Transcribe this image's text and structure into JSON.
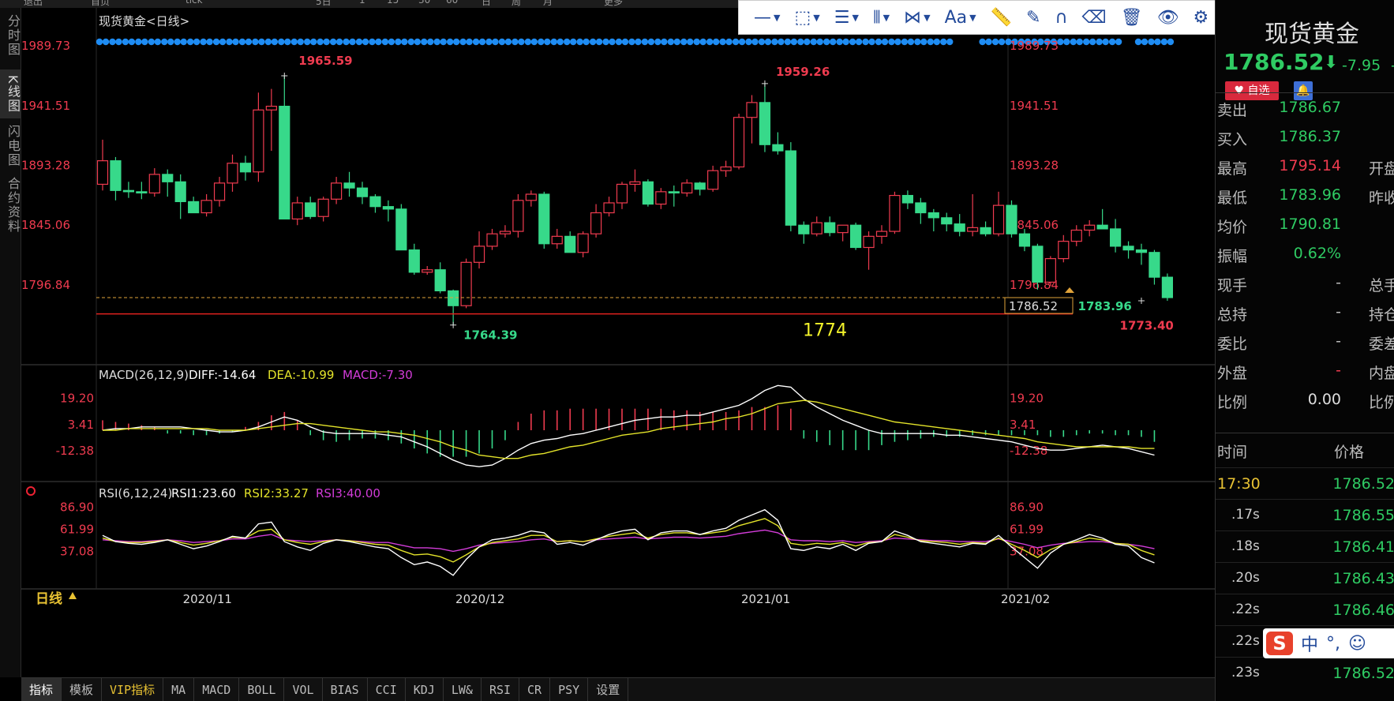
{
  "top_tabs": [
    "退出",
    "首页",
    "tick",
    "5日",
    "1",
    "15",
    "30",
    "60",
    "日",
    "周",
    "月",
    "更多"
  ],
  "left_tabs": [
    {
      "label": "分时图",
      "active": false
    },
    {
      "label": "K线图",
      "active": true
    },
    {
      "label": "闪电图",
      "active": false
    },
    {
      "label": "合约资料",
      "active": false
    }
  ],
  "toolbar": {
    "icons": [
      "line-tool-icon",
      "rect-tool-icon",
      "fib-tool-icon",
      "period-tool-icon",
      "pattern-tool-icon",
      "text-tool-icon",
      "ruler-icon",
      "pen-icon",
      "magnet-icon",
      "eraser-icon",
      "trash-icon",
      "eye-icon",
      "gear-icon",
      "close-icon"
    ],
    "text_label": "Aa"
  },
  "chart_data": [
    {
      "type": "candlestick",
      "title": "现货黄金<日线>",
      "ylim": [
        1740,
        2000
      ],
      "y_ticks": [
        1989.73,
        1941.51,
        1893.28,
        1845.06,
        1796.84
      ],
      "x_tick_labels": [
        "2020/11",
        "2020/12",
        "2021/01",
        "2021/02"
      ],
      "x_tick_indices": [
        8,
        29,
        51,
        71
      ],
      "up_color": "#ef3b4f",
      "down_color": "#37d98a",
      "ohlc": [
        [
          1878,
          1914,
          1873,
          1897
        ],
        [
          1897,
          1900,
          1865,
          1873
        ],
        [
          1873,
          1880,
          1867,
          1872
        ],
        [
          1872,
          1880,
          1866,
          1871
        ],
        [
          1871,
          1891,
          1868,
          1886
        ],
        [
          1886,
          1890,
          1868,
          1880
        ],
        [
          1880,
          1886,
          1850,
          1864
        ],
        [
          1864,
          1868,
          1855,
          1855
        ],
        [
          1855,
          1870,
          1852,
          1865
        ],
        [
          1865,
          1884,
          1860,
          1879
        ],
        [
          1879,
          1902,
          1872,
          1895
        ],
        [
          1895,
          1901,
          1881,
          1888
        ],
        [
          1888,
          1952,
          1880,
          1938
        ],
        [
          1938,
          1955,
          1905,
          1941
        ],
        [
          1941,
          1965.59,
          1850,
          1850
        ],
        [
          1850,
          1868,
          1845,
          1863
        ],
        [
          1863,
          1868,
          1850,
          1852
        ],
        [
          1852,
          1868,
          1848,
          1866
        ],
        [
          1866,
          1884,
          1862,
          1879
        ],
        [
          1879,
          1888,
          1868,
          1875
        ],
        [
          1875,
          1880,
          1862,
          1868
        ],
        [
          1868,
          1870,
          1855,
          1860
        ],
        [
          1860,
          1865,
          1848,
          1858
        ],
        [
          1858,
          1862,
          1825,
          1825
        ],
        [
          1825,
          1830,
          1805,
          1807
        ],
        [
          1807,
          1812,
          1805,
          1809
        ],
        [
          1809,
          1815,
          1790,
          1792
        ],
        [
          1792,
          1793,
          1764.39,
          1780
        ],
        [
          1780,
          1818,
          1778,
          1815
        ],
        [
          1815,
          1840,
          1810,
          1828
        ],
        [
          1828,
          1842,
          1825,
          1838
        ],
        [
          1838,
          1845,
          1835,
          1840
        ],
        [
          1840,
          1870,
          1835,
          1865
        ],
        [
          1865,
          1873,
          1860,
          1870
        ],
        [
          1870,
          1872,
          1826,
          1830
        ],
        [
          1830,
          1842,
          1826,
          1836
        ],
        [
          1836,
          1840,
          1824,
          1823
        ],
        [
          1823,
          1840,
          1819,
          1838
        ],
        [
          1838,
          1862,
          1835,
          1855
        ],
        [
          1855,
          1868,
          1852,
          1863
        ],
        [
          1863,
          1880,
          1858,
          1878
        ],
        [
          1878,
          1890,
          1872,
          1880
        ],
        [
          1880,
          1882,
          1860,
          1862
        ],
        [
          1862,
          1875,
          1858,
          1872
        ],
        [
          1872,
          1877,
          1860,
          1871
        ],
        [
          1871,
          1882,
          1868,
          1879
        ],
        [
          1879,
          1880,
          1869,
          1874
        ],
        [
          1874,
          1893,
          1872,
          1889
        ],
        [
          1889,
          1897,
          1884,
          1892
        ],
        [
          1892,
          1935,
          1890,
          1932
        ],
        [
          1932,
          1950,
          1911,
          1944
        ],
        [
          1944,
          1959.26,
          1904,
          1910
        ],
        [
          1910,
          1920,
          1902,
          1905
        ],
        [
          1905,
          1912,
          1840,
          1845
        ],
        [
          1845,
          1848,
          1830,
          1838
        ],
        [
          1838,
          1852,
          1836,
          1847
        ],
        [
          1847,
          1852,
          1836,
          1839
        ],
        [
          1839,
          1845,
          1832,
          1845
        ],
        [
          1845,
          1847,
          1825,
          1827
        ],
        [
          1827,
          1840,
          1809,
          1836
        ],
        [
          1836,
          1845,
          1830,
          1840
        ],
        [
          1840,
          1872,
          1838,
          1869
        ],
        [
          1869,
          1873,
          1858,
          1863
        ],
        [
          1863,
          1867,
          1846,
          1855
        ],
        [
          1855,
          1858,
          1840,
          1851
        ],
        [
          1851,
          1855,
          1840,
          1846
        ],
        [
          1846,
          1854,
          1836,
          1840
        ],
        [
          1840,
          1870,
          1836,
          1843
        ],
        [
          1843,
          1848,
          1836,
          1838
        ],
        [
          1838,
          1872,
          1836,
          1861
        ],
        [
          1861,
          1865,
          1835,
          1838
        ],
        [
          1838,
          1842,
          1824,
          1828
        ],
        [
          1828,
          1830,
          1793,
          1799
        ],
        [
          1799,
          1820,
          1796,
          1818
        ],
        [
          1818,
          1837,
          1815,
          1832
        ],
        [
          1832,
          1845,
          1828,
          1841
        ],
        [
          1841,
          1849,
          1836,
          1845
        ],
        [
          1845,
          1858,
          1842,
          1842
        ],
        [
          1842,
          1850,
          1823,
          1828
        ],
        [
          1828,
          1832,
          1818,
          1825
        ],
        [
          1825,
          1830,
          1813,
          1823
        ],
        [
          1823,
          1825,
          1797,
          1803
        ],
        [
          1803,
          1806,
          1783.96,
          1786.52
        ]
      ],
      "labels": {
        "high1": "1965.59",
        "high2": "1959.26",
        "low1": "1764.39",
        "low_recent": "1783.96",
        "red_line_tag": "1773.40",
        "current_tag": "1786.52",
        "note": "1774"
      },
      "red_line_value": 1773.4,
      "current_value": 1786.52,
      "dots_color": "#1e8cf3"
    },
    {
      "type": "bar",
      "title": "MACD(26,12,9)",
      "series_labels": {
        "diff": "DIFF:-14.64",
        "dea": "DEA:-10.99",
        "macd": "MACD:-7.30"
      },
      "colors": {
        "diff": "#ffffff",
        "dea": "#e3e32a",
        "macd": "#d23cd8"
      },
      "ylim": [
        -30,
        30
      ],
      "y_ticks": [
        19.2,
        3.41,
        -12.38
      ],
      "diff": [
        0,
        1,
        1,
        2,
        2,
        2,
        2,
        1,
        0,
        -1,
        -1,
        0,
        2,
        5,
        8,
        6,
        2,
        -1,
        -2,
        -2,
        -2,
        -2,
        -3,
        -4,
        -7,
        -10,
        -14,
        -18,
        -21,
        -22,
        -21,
        -17,
        -12,
        -8,
        -6,
        -5,
        -3,
        -2,
        0,
        2,
        4,
        6,
        7,
        8,
        8,
        9,
        9,
        11,
        13,
        15,
        19,
        24,
        27,
        26,
        19,
        14,
        10,
        6,
        3,
        0,
        -2,
        -2,
        -2,
        -2,
        -2,
        -3,
        -3,
        -4,
        -5,
        -6,
        -7,
        -9,
        -11,
        -12,
        -12,
        -11,
        -10,
        -9,
        -10,
        -11,
        -13,
        -15
      ],
      "dea": [
        0,
        0,
        1,
        1,
        1,
        1,
        1,
        1,
        1,
        0,
        0,
        0,
        1,
        2,
        3,
        4,
        4,
        3,
        2,
        1,
        0,
        -1,
        -1,
        -2,
        -3,
        -5,
        -7,
        -10,
        -12,
        -15,
        -16,
        -17,
        -17,
        -15,
        -14,
        -12,
        -10,
        -9,
        -7,
        -5,
        -3,
        -2,
        -1,
        1,
        2,
        3,
        4,
        5,
        7,
        8,
        10,
        13,
        16,
        17,
        18,
        17,
        15,
        13,
        11,
        9,
        7,
        5,
        4,
        3,
        2,
        1,
        0,
        -1,
        -2,
        -3,
        -4,
        -5,
        -7,
        -8,
        -9,
        -10,
        -10,
        -10,
        -10,
        -10,
        -11,
        -11
      ],
      "macd": [
        6,
        5,
        4,
        3,
        2,
        -2,
        -2,
        -3,
        -3,
        -2,
        -1,
        2,
        5,
        9,
        11,
        6,
        -3,
        -6,
        -7,
        -6,
        -5,
        -5,
        -6,
        -8,
        -11,
        -14,
        -16,
        -16,
        -16,
        -14,
        -11,
        -6,
        5,
        10,
        12,
        12,
        13,
        13,
        13,
        13,
        13,
        13,
        13,
        13,
        12,
        12,
        11,
        11,
        11,
        12,
        14,
        14,
        15,
        13,
        -5,
        -7,
        -9,
        -12,
        -12,
        -12,
        -9,
        -7,
        -6,
        -5,
        -4,
        -4,
        -4,
        -3,
        -3,
        -3,
        -3,
        -3,
        -3,
        -4,
        -4,
        -3,
        -2,
        -2,
        -3,
        -3,
        -4,
        -7
      ]
    },
    {
      "type": "line",
      "title": "RSI(6,12,24)",
      "series_labels": {
        "rsi1": "RSI1:23.60",
        "rsi2": "RSI2:33.27",
        "rsi3": "RSI3:40.00"
      },
      "colors": {
        "rsi1": "#ffffff",
        "rsi2": "#e3e32a",
        "rsi3": "#d23cd8"
      },
      "ylim": [
        0,
        100
      ],
      "y_ticks": [
        86.9,
        61.99,
        37.08
      ],
      "rsi1": [
        55,
        48,
        46,
        45,
        47,
        50,
        45,
        40,
        43,
        48,
        54,
        52,
        68,
        70,
        48,
        42,
        38,
        46,
        50,
        48,
        45,
        42,
        40,
        30,
        22,
        25,
        20,
        10,
        28,
        42,
        50,
        52,
        55,
        60,
        58,
        45,
        47,
        44,
        50,
        56,
        60,
        62,
        50,
        58,
        60,
        60,
        56,
        60,
        63,
        72,
        78,
        84,
        72,
        40,
        38,
        42,
        40,
        45,
        38,
        46,
        48,
        60,
        55,
        48,
        46,
        44,
        42,
        46,
        45,
        55,
        42,
        30,
        18,
        35,
        45,
        50,
        56,
        52,
        45,
        43,
        30,
        24
      ],
      "rsi2": [
        52,
        48,
        47,
        47,
        48,
        50,
        47,
        44,
        46,
        49,
        53,
        52,
        60,
        62,
        50,
        47,
        45,
        48,
        50,
        49,
        47,
        45,
        44,
        38,
        33,
        34,
        31,
        25,
        33,
        42,
        47,
        49,
        51,
        55,
        55,
        48,
        49,
        48,
        51,
        54,
        56,
        58,
        52,
        56,
        58,
        58,
        56,
        58,
        60,
        66,
        70,
        74,
        66,
        46,
        44,
        46,
        45,
        47,
        43,
        47,
        48,
        56,
        53,
        49,
        48,
        47,
        45,
        47,
        46,
        52,
        45,
        38,
        30,
        39,
        45,
        48,
        52,
        50,
        46,
        45,
        38,
        33
      ],
      "rsi3": [
        50,
        49,
        48,
        48,
        49,
        50,
        49,
        47,
        48,
        49,
        51,
        51,
        54,
        56,
        50,
        49,
        48,
        49,
        50,
        49,
        48,
        47,
        47,
        44,
        41,
        41,
        40,
        37,
        40,
        44,
        46,
        47,
        48,
        50,
        51,
        48,
        49,
        48,
        50,
        51,
        52,
        53,
        51,
        52,
        53,
        53,
        52,
        53,
        54,
        57,
        59,
        61,
        58,
        50,
        49,
        49,
        48,
        49,
        47,
        48,
        49,
        52,
        51,
        50,
        49,
        49,
        48,
        48,
        48,
        51,
        48,
        45,
        41,
        44,
        46,
        47,
        48,
        48,
        46,
        45,
        43,
        40
      ]
    }
  ],
  "period_label": "日线",
  "bottom_tabs": [
    "指标",
    "模板",
    "VIP指标",
    "MA",
    "MACD",
    "BOLL",
    "VOL",
    "BIAS",
    "CCI",
    "KDJ",
    "LW&",
    "RSI",
    "CR",
    "PSY",
    "设置"
  ],
  "panel": {
    "title": "现货黄金",
    "price": "1786.52",
    "change": "-7.95",
    "fav_label": "自选",
    "quotes": [
      {
        "label": "卖出",
        "value": "1786.67",
        "color": "#2fcb63",
        "right": ""
      },
      {
        "label": "买入",
        "value": "1786.37",
        "color": "#2fcb63",
        "right": ""
      },
      {
        "label": "最高",
        "value": "1795.14",
        "color": "#ef3b4f",
        "right": "开盘"
      },
      {
        "label": "最低",
        "value": "1783.96",
        "color": "#2fcb63",
        "right": "昨收"
      },
      {
        "label": "均价",
        "value": "1790.81",
        "color": "#2fcb63",
        "right": ""
      },
      {
        "label": "振幅",
        "value": "0.62%",
        "color": "#2fcb63",
        "right": ""
      },
      {
        "label": "现手",
        "value": "-",
        "color": "#bbb",
        "right": "总手"
      },
      {
        "label": "总持",
        "value": "-",
        "color": "#bbb",
        "right": "持仓"
      },
      {
        "label": "委比",
        "value": "-",
        "color": "#bbb",
        "right": "委差"
      },
      {
        "label": "外盘",
        "value": "-",
        "color": "#ef3b4f",
        "right": "内盘"
      },
      {
        "label": "比例",
        "value": "0.00",
        "color": "#ddd",
        "right": "比例"
      }
    ],
    "tick_headers": {
      "time": "时间",
      "price": "价格"
    },
    "ticks": [
      {
        "time": "17:30",
        "price": "1786.52"
      },
      {
        "time": ".17s",
        "price": "1786.55"
      },
      {
        "time": ".18s",
        "price": "1786.41"
      },
      {
        "time": ".20s",
        "price": "1786.43"
      },
      {
        "time": ".22s",
        "price": "1786.46"
      },
      {
        "time": ".22s",
        "price": ""
      },
      {
        "time": ".23s",
        "price": "1786.52"
      }
    ]
  },
  "ime": {
    "logo": "S",
    "items": [
      "中",
      "°,",
      "☺"
    ]
  }
}
